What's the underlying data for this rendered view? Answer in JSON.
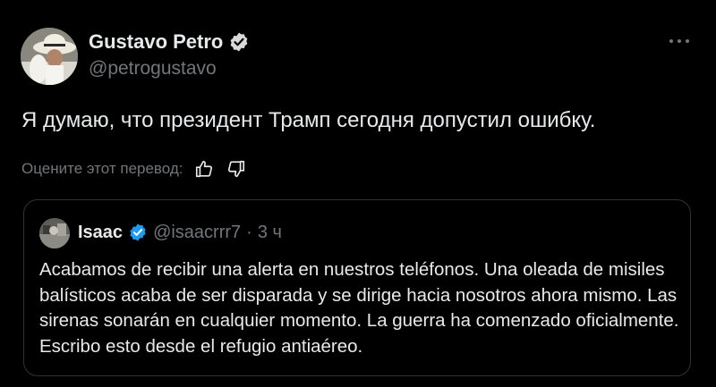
{
  "post": {
    "author": {
      "display_name": "Gustavo Petro",
      "handle": "@petrogustavo",
      "verified": true
    },
    "text": "Я думаю, что президент Трамп сегодня допустил ошибку.",
    "translation_feedback": {
      "label": "Оцените этот перевод:",
      "like_icon": "thumbs-up-icon",
      "dislike_icon": "thumbs-down-icon"
    },
    "more_icon": "more-horizontal-icon"
  },
  "quote": {
    "author": {
      "display_name": "Isaac",
      "handle": "@isaacrrr7",
      "separator": "·",
      "time": "3 ч",
      "verified": true
    },
    "text": "Acabamos de recibir una alerta en nuestros teléfonos. Una oleada de misiles balísticos acaba de ser disparada y se dirige hacia nosotros ahora mismo. Las sirenas sonarán en cualquier momento. La guerra ha comenzado oficialmente. Escribo esto desde el refugio antiaéreo."
  },
  "colors": {
    "background": "#000000",
    "text_primary": "#e7e9ea",
    "text_secondary": "#71767b",
    "verified_blue": "#1d9bf0",
    "border": "#2f3336"
  }
}
